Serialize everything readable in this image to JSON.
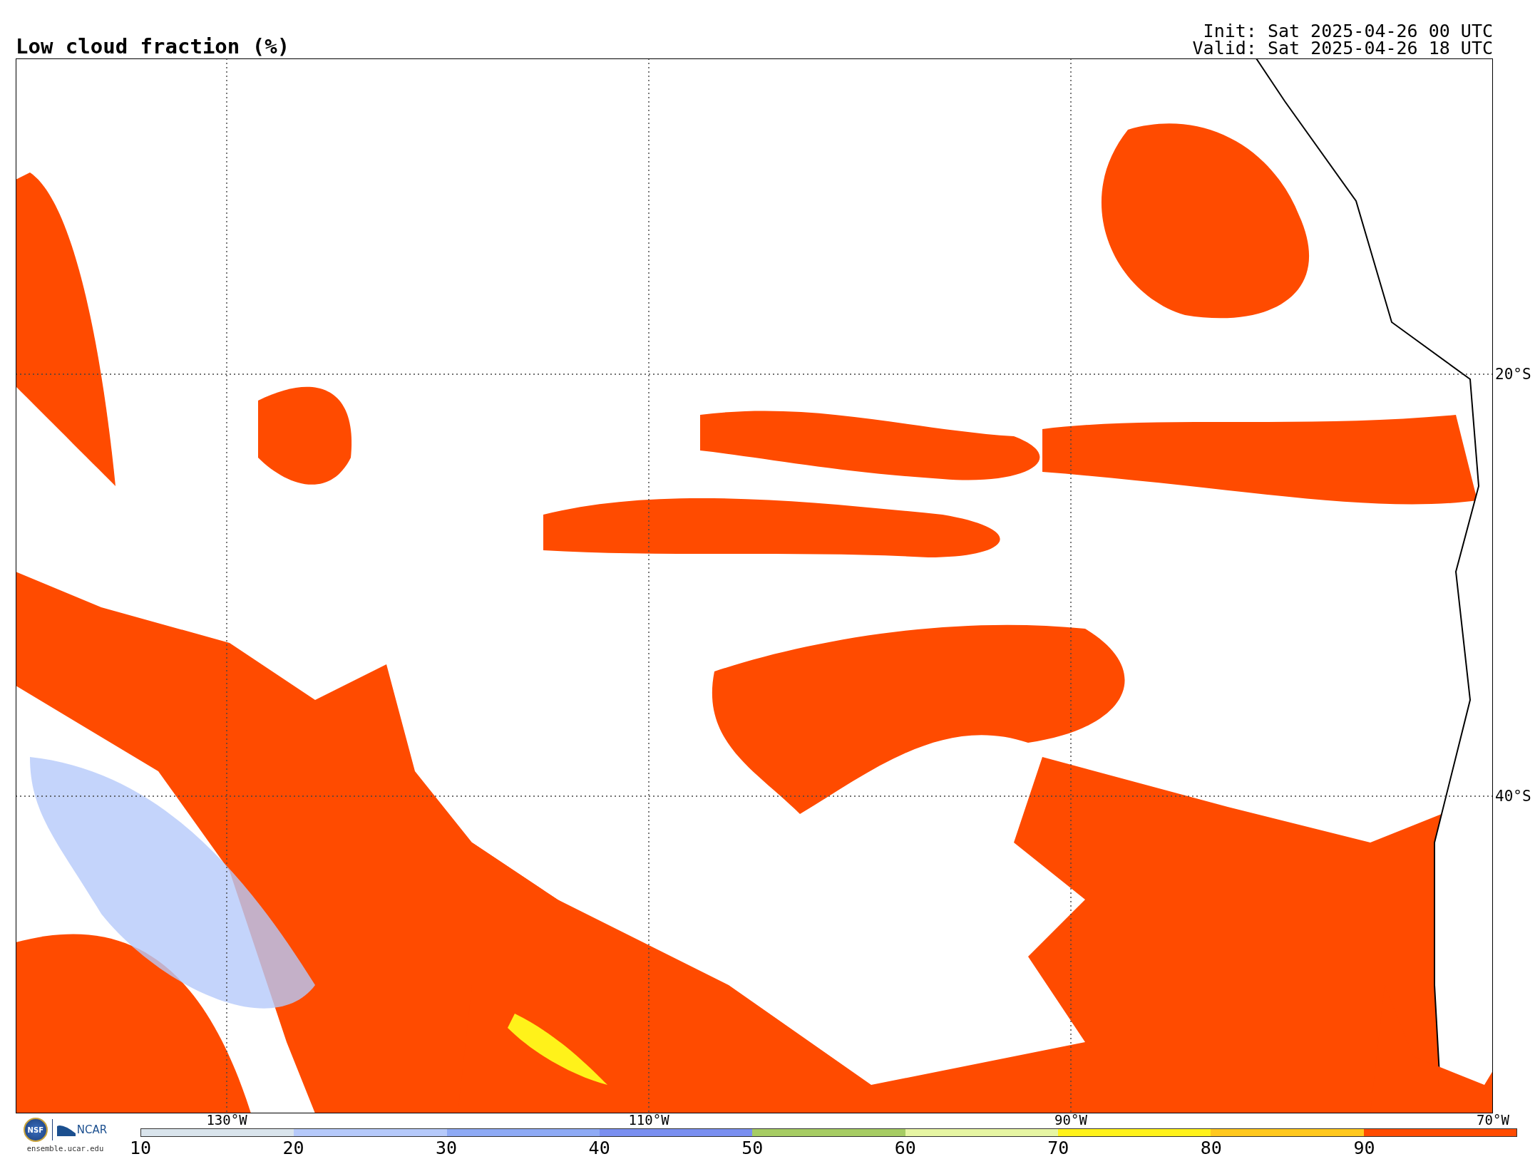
{
  "title": "Low cloud fraction (%)",
  "init": "Init: Sat 2025-04-26 00 UTC",
  "valid": "Valid: Sat 2025-04-26 18 UTC",
  "map": {
    "lon_labels": [
      "130°W",
      "110°W",
      "90°W",
      "70°W"
    ],
    "lat_labels": [
      "20°S",
      "40°S"
    ]
  },
  "logos": {
    "nsf": "NSF",
    "ncar": "NCAR",
    "url": "ensemble.ucar.edu"
  },
  "colorbar": {
    "bins": [
      {
        "color": "#d9e4ec"
      },
      {
        "color": "#b5c9fa"
      },
      {
        "color": "#8eaaf5"
      },
      {
        "color": "#7a8ff0"
      },
      {
        "color": "#a6cc63"
      },
      {
        "color": "#e6f5a3"
      },
      {
        "color": "#fff21a"
      },
      {
        "color": "#ffc81e"
      },
      {
        "color": "#ff4b00"
      }
    ],
    "ticks": [
      "10",
      "20",
      "30",
      "40",
      "50",
      "60",
      "70",
      "80",
      "90"
    ]
  }
}
